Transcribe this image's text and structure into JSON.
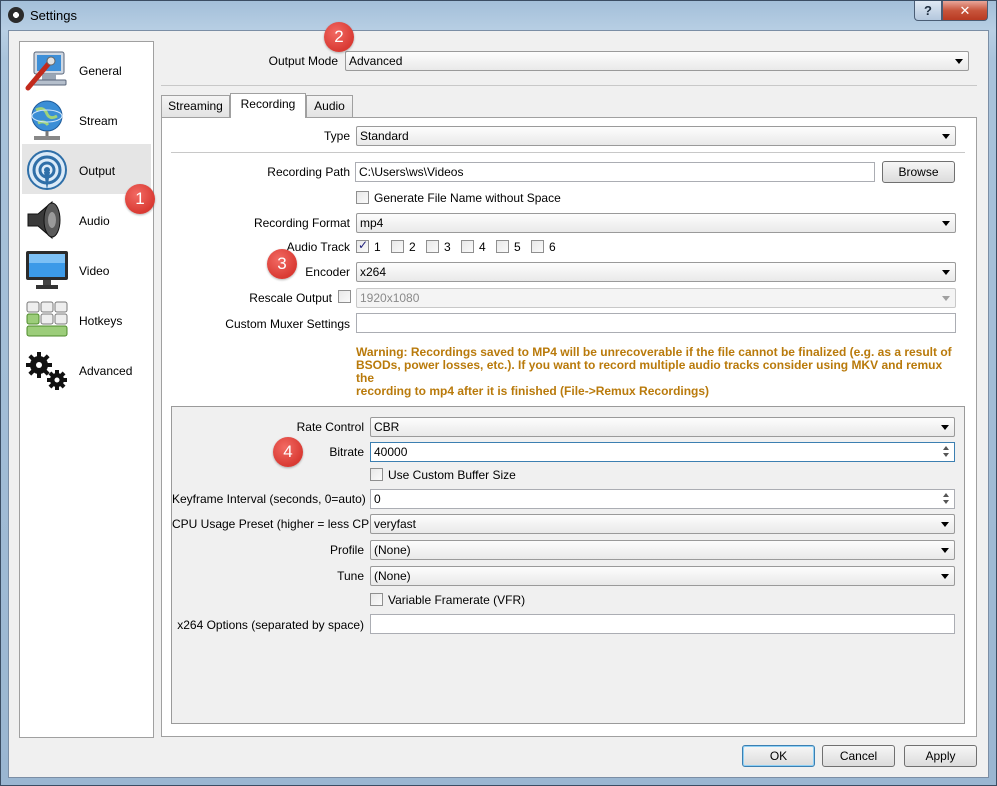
{
  "window": {
    "title": "Settings",
    "help_label": "?",
    "close_label": "✕"
  },
  "sidebar": {
    "items": [
      {
        "label": "General",
        "icon": "general-icon"
      },
      {
        "label": "Stream",
        "icon": "stream-globe-icon"
      },
      {
        "label": "Output",
        "icon": "output-broadcast-icon",
        "selected": true
      },
      {
        "label": "Audio",
        "icon": "speaker-icon"
      },
      {
        "label": "Video",
        "icon": "monitor-icon"
      },
      {
        "label": "Hotkeys",
        "icon": "keyboard-icon"
      },
      {
        "label": "Advanced",
        "icon": "gears-icon"
      }
    ]
  },
  "output_mode": {
    "label": "Output Mode",
    "value": "Advanced"
  },
  "tabs": [
    {
      "label": "Streaming"
    },
    {
      "label": "Recording",
      "active": true
    },
    {
      "label": "Audio"
    }
  ],
  "recording": {
    "type_label": "Type",
    "type_value": "Standard",
    "path_label": "Recording Path",
    "path_value": "C:\\Users\\ws\\Videos",
    "browse_label": "Browse",
    "gen_filename_label": "Generate File Name without Space",
    "gen_filename_checked": false,
    "format_label": "Recording Format",
    "format_value": "mp4",
    "audio_track_label": "Audio Track",
    "audio_tracks": [
      {
        "label": "1",
        "checked": true
      },
      {
        "label": "2",
        "checked": false
      },
      {
        "label": "3",
        "checked": false
      },
      {
        "label": "4",
        "checked": false
      },
      {
        "label": "5",
        "checked": false
      },
      {
        "label": "6",
        "checked": false
      }
    ],
    "encoder_label": "Encoder",
    "encoder_value": "x264",
    "rescale_label": "Rescale Output",
    "rescale_checked": false,
    "rescale_value": "1920x1080",
    "muxer_label": "Custom Muxer Settings",
    "muxer_value": "",
    "warning_lines": [
      "Warning: Recordings saved to MP4 will be unrecoverable if the file cannot be finalized (e.g. as a result of",
      "BSODs, power losses, etc.). If you want to record multiple audio tracks consider using MKV and remux the",
      "recording to mp4 after it is finished (File->Remux Recordings)"
    ]
  },
  "encoder_settings": {
    "rate_control_label": "Rate Control",
    "rate_control_value": "CBR",
    "bitrate_label": "Bitrate",
    "bitrate_value": "40000",
    "custom_buffer_label": "Use Custom Buffer Size",
    "custom_buffer_checked": false,
    "keyframe_label": "Keyframe Interval (seconds, 0=auto)",
    "keyframe_value": "0",
    "cpu_preset_label": "CPU Usage Preset (higher = less CPU)",
    "cpu_preset_value": "veryfast",
    "profile_label": "Profile",
    "profile_value": "(None)",
    "tune_label": "Tune",
    "tune_value": "(None)",
    "vfr_label": "Variable Framerate (VFR)",
    "vfr_checked": false,
    "x264_options_label": "x264 Options (separated by space)",
    "x264_options_value": ""
  },
  "annotations": {
    "badge_1": "1",
    "badge_2": "2",
    "badge_3": "3",
    "badge_4": "4",
    "color": "#d93a33"
  },
  "buttons": {
    "ok": "OK",
    "cancel": "Cancel",
    "apply": "Apply"
  }
}
